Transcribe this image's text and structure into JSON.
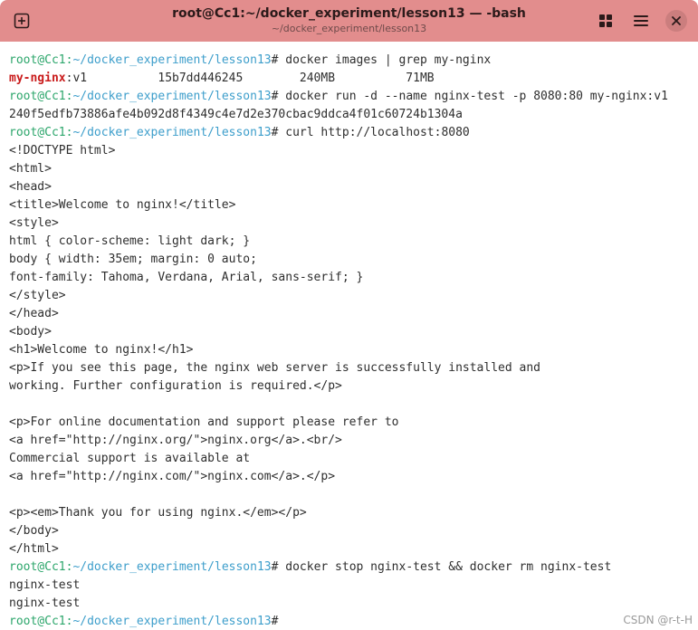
{
  "window": {
    "title": "root@Cc1:~/docker_experiment/lesson13 — -bash",
    "subtitle": "~/docker_experiment/lesson13",
    "titlebar_color": "#e28d8d",
    "buttons": {
      "new_tab_icon": "plus-square-icon",
      "view_icon": "grid-icon",
      "menu_icon": "hamburger-menu-icon",
      "close_icon": "close-icon"
    }
  },
  "prompt": {
    "user_host": "root@Cc1",
    "separator": ":",
    "path": "~/docker_experiment/lesson13",
    "symbol": "#",
    "user_color": "#2ca66b",
    "path_color": "#3d9ecb"
  },
  "terminal": {
    "lines": [
      {
        "type": "cmd",
        "text": " docker images | grep my-nginx"
      },
      {
        "type": "hl",
        "highlight": "my-nginx",
        "text": ":v1          15b7dd446245        240MB          71MB"
      },
      {
        "type": "cmd",
        "text": " docker run -d --name nginx-test -p 8080:80 my-nginx:v1"
      },
      {
        "type": "out",
        "text": "240f5edfb73886afe4b092d8f4349c4e7d2e370cbac9ddca4f01c60724b1304a"
      },
      {
        "type": "cmd",
        "text": " curl http://localhost:8080"
      },
      {
        "type": "out",
        "text": "<!DOCTYPE html>"
      },
      {
        "type": "out",
        "text": "<html>"
      },
      {
        "type": "out",
        "text": "<head>"
      },
      {
        "type": "out",
        "text": "<title>Welcome to nginx!</title>"
      },
      {
        "type": "out",
        "text": "<style>"
      },
      {
        "type": "out",
        "text": "html { color-scheme: light dark; }"
      },
      {
        "type": "out",
        "text": "body { width: 35em; margin: 0 auto;"
      },
      {
        "type": "out",
        "text": "font-family: Tahoma, Verdana, Arial, sans-serif; }"
      },
      {
        "type": "out",
        "text": "</style>"
      },
      {
        "type": "out",
        "text": "</head>"
      },
      {
        "type": "out",
        "text": "<body>"
      },
      {
        "type": "out",
        "text": "<h1>Welcome to nginx!</h1>"
      },
      {
        "type": "out",
        "text": "<p>If you see this page, the nginx web server is successfully installed and"
      },
      {
        "type": "out",
        "text": "working. Further configuration is required.</p>"
      },
      {
        "type": "out",
        "text": ""
      },
      {
        "type": "out",
        "text": "<p>For online documentation and support please refer to"
      },
      {
        "type": "out",
        "text": "<a href=\"http://nginx.org/\">nginx.org</a>.<br/>"
      },
      {
        "type": "out",
        "text": "Commercial support is available at"
      },
      {
        "type": "out",
        "text": "<a href=\"http://nginx.com/\">nginx.com</a>.</p>"
      },
      {
        "type": "out",
        "text": ""
      },
      {
        "type": "out",
        "text": "<p><em>Thank you for using nginx.</em></p>"
      },
      {
        "type": "out",
        "text": "</body>"
      },
      {
        "type": "out",
        "text": "</html>"
      },
      {
        "type": "cmd",
        "text": " docker stop nginx-test && docker rm nginx-test"
      },
      {
        "type": "out",
        "text": "nginx-test"
      },
      {
        "type": "out",
        "text": "nginx-test"
      },
      {
        "type": "cmd",
        "text": ""
      }
    ]
  },
  "watermark": "CSDN @r-t-H"
}
